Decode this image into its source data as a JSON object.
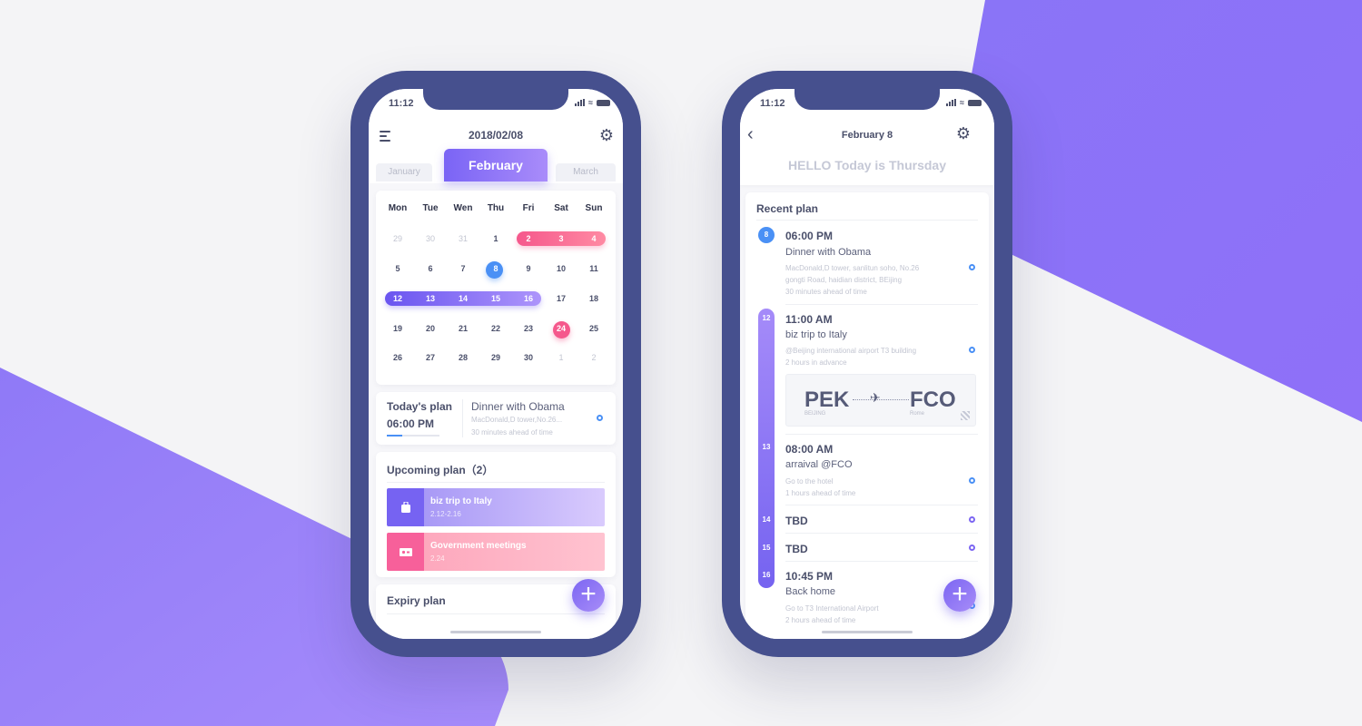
{
  "colors": {
    "accent_purple": "#7c66f2",
    "accent_pink": "#f5588c",
    "accent_blue": "#4a90f5",
    "phone_frame": "#46508e",
    "background": "#f4f4f6"
  },
  "left_phone": {
    "status": {
      "time": "11:12"
    },
    "header": {
      "title": "2018/02/08",
      "menu_icon": "menu-icon",
      "settings_icon": "gear-icon"
    },
    "month_tabs": {
      "prev": "January",
      "active": "February",
      "next": "March"
    },
    "calendar": {
      "weekdays": [
        "Mon",
        "Tue",
        "Wen",
        "Thu",
        "Fri",
        "Sat",
        "Sun"
      ],
      "weeks": [
        [
          "29",
          "30",
          "31",
          "1",
          "2",
          "3",
          "4"
        ],
        [
          "5",
          "6",
          "7",
          "8",
          "9",
          "10",
          "11"
        ],
        [
          "12",
          "13",
          "14",
          "15",
          "16",
          "17",
          "18"
        ],
        [
          "19",
          "20",
          "21",
          "22",
          "23",
          "24",
          "25"
        ],
        [
          "26",
          "27",
          "28",
          "29",
          "30",
          "1",
          "2"
        ]
      ],
      "today": "8",
      "highlight_pink_range": [
        "2",
        "4"
      ],
      "highlight_purple_range": [
        "12",
        "16"
      ],
      "marked_day": "24"
    },
    "todays_plan": {
      "label": "Today's plan",
      "time": "06:00 PM",
      "progress": 0.3,
      "title": "Dinner with Obama",
      "address": "MacDonald,D tower,No.26...",
      "note": "30 minutes ahead of time"
    },
    "upcoming": {
      "title": "Upcoming plan（2）",
      "items": [
        {
          "title": "biz trip to Italy",
          "date": "2.12-2.16",
          "icon": "luggage-icon"
        },
        {
          "title": "Government meetings",
          "date": "2.24",
          "icon": "ticket-icon"
        }
      ]
    },
    "expiry": {
      "title": "Expiry plan"
    },
    "fab": "+"
  },
  "right_phone": {
    "status": {
      "time": "11:12"
    },
    "header": {
      "title": "February 8",
      "back_icon": "chevron-left-icon",
      "settings_icon": "gear-icon"
    },
    "greeting": "HELLO Today is Thursday",
    "recent": {
      "title": "Recent plan",
      "events": [
        {
          "day": "8",
          "time": "06:00 PM",
          "title": "Dinner with Obama",
          "lines": [
            "MacDonald,D tower, sanlitun soho, No.26",
            "gongti Road, haidian district, BEijing",
            "30 minutes ahead of time"
          ]
        },
        {
          "day": "12",
          "time": "11:00 AM",
          "title": "biz trip to Italy",
          "lines": [
            "@Beijing international airport T3 building",
            "2 hours in advance"
          ]
        },
        {
          "day": "13",
          "time": "08:00 AM",
          "title": "arraival @FCO",
          "lines": [
            "Go to the hotel",
            "1 hours ahead of time"
          ]
        },
        {
          "day": "14",
          "time": "TBD"
        },
        {
          "day": "15",
          "time": "TBD"
        },
        {
          "day": "16",
          "time": "10:45 PM",
          "title": "Back home",
          "lines": [
            "Go to T3 International Airport",
            "2 hours ahead of time"
          ]
        }
      ],
      "ticket": {
        "from_code": "PEK",
        "from_city": "BEIJING",
        "to_code": "FCO",
        "to_city": "Rome"
      }
    },
    "fab": "+"
  }
}
